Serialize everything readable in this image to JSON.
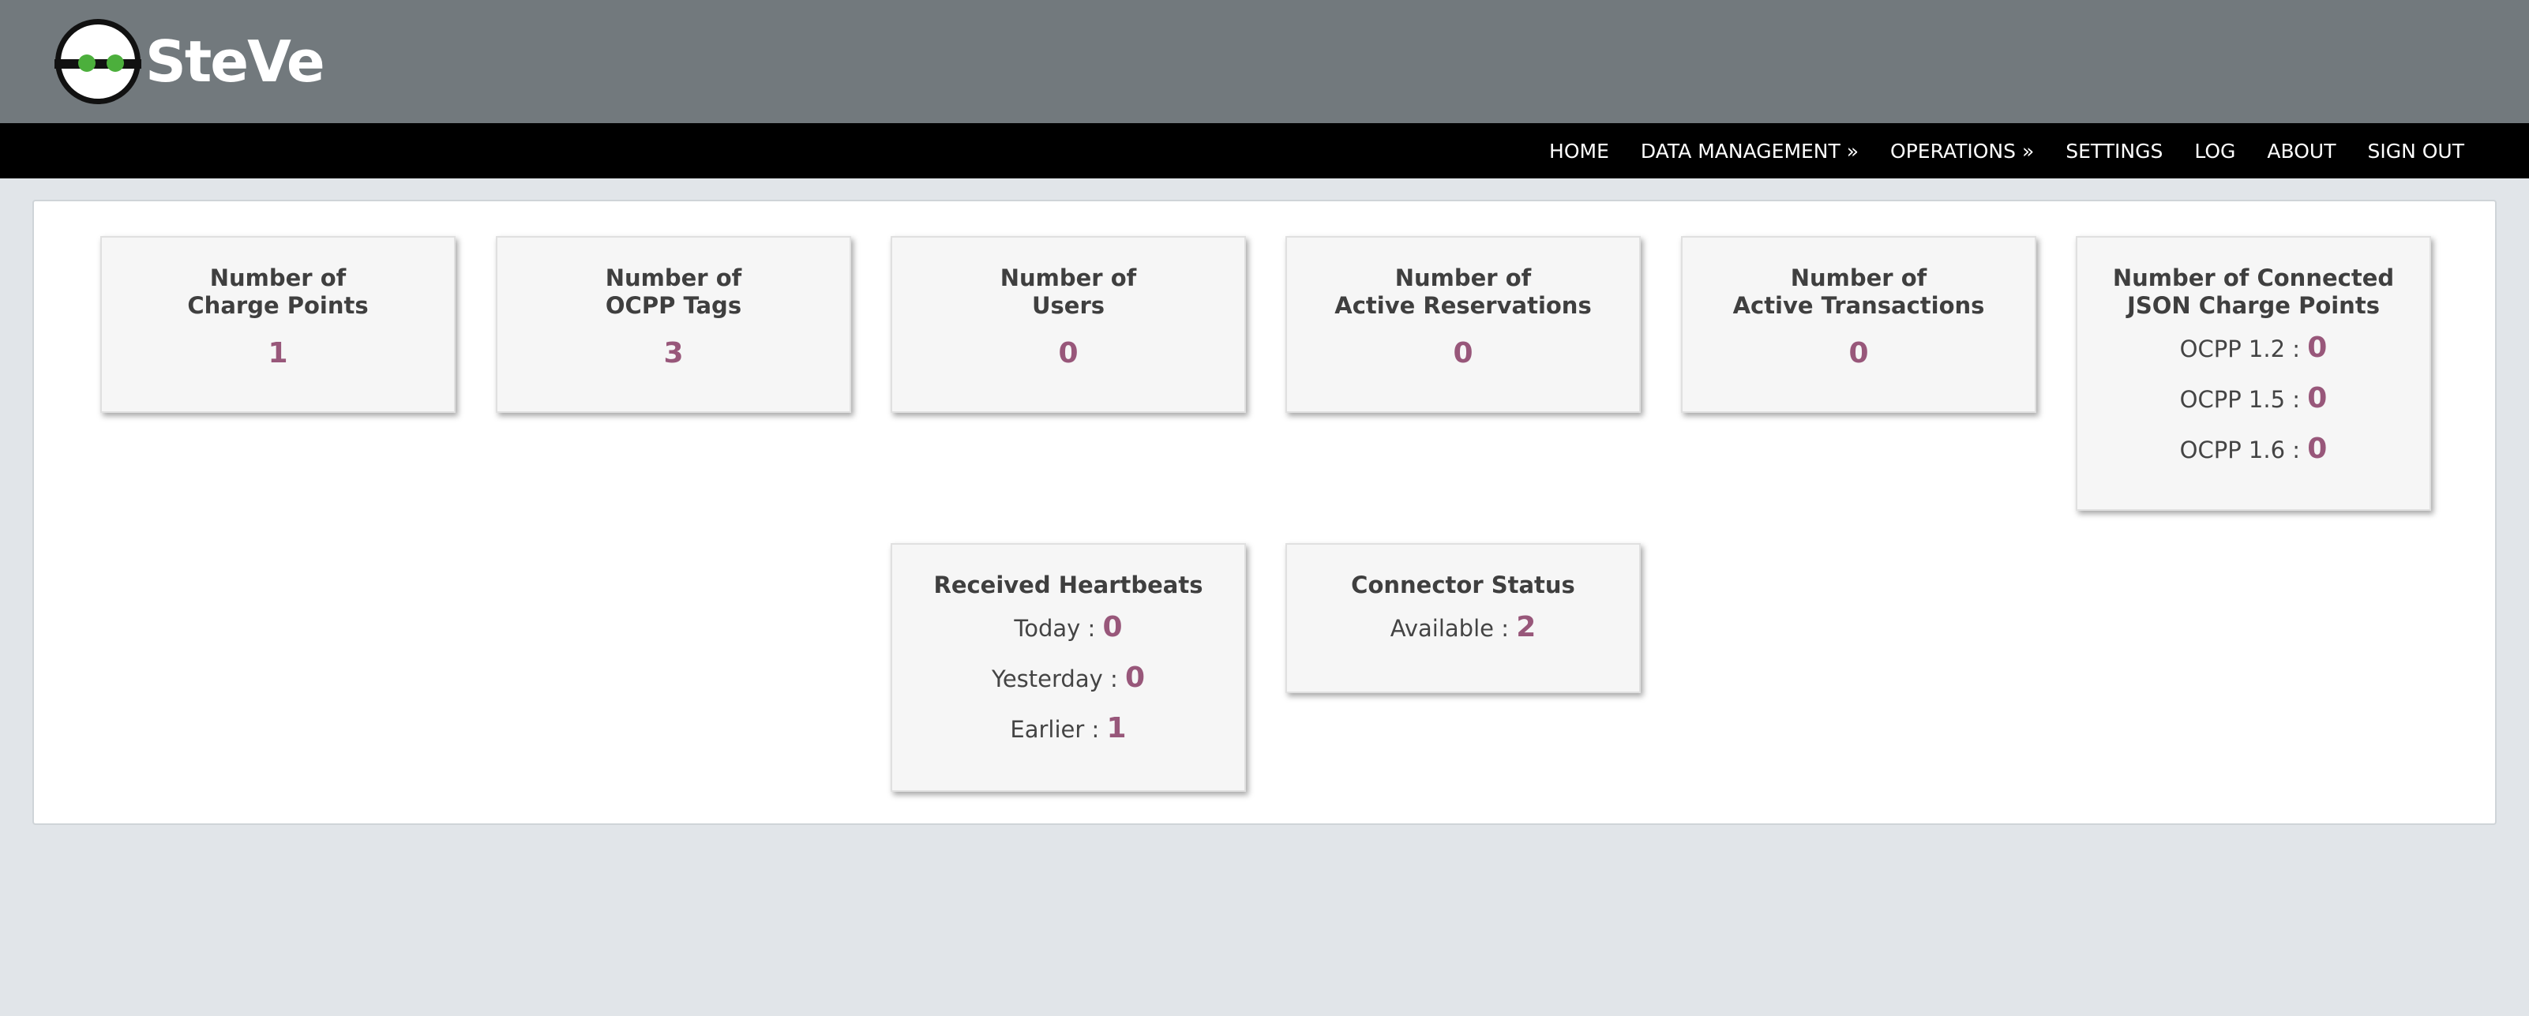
{
  "header": {
    "logo_text": "SteVe"
  },
  "nav": {
    "items": [
      "HOME",
      "DATA MANAGEMENT »",
      "OPERATIONS »",
      "SETTINGS",
      "LOG",
      "ABOUT",
      "SIGN OUT"
    ]
  },
  "stats": {
    "charge_points": {
      "line1": "Number of",
      "line2": "Charge Points",
      "value": "1"
    },
    "ocpp_tags": {
      "line1": "Number of",
      "line2": "OCPP Tags",
      "value": "3"
    },
    "users": {
      "line1": "Number of",
      "line2": "Users",
      "value": "0"
    },
    "reservations": {
      "line1": "Number of",
      "line2": "Active Reservations",
      "value": "0"
    },
    "transactions": {
      "line1": "Number of",
      "line2": "Active Transactions",
      "value": "0"
    },
    "json_cp": {
      "line1": "Number of Connected",
      "line2": "JSON Charge Points",
      "rows": [
        {
          "label": "OCPP 1.2",
          "value": "0"
        },
        {
          "label": "OCPP 1.5",
          "value": "0"
        },
        {
          "label": "OCPP 1.6",
          "value": "0"
        }
      ]
    },
    "heartbeats": {
      "title": "Received Heartbeats",
      "rows": [
        {
          "label": "Today",
          "value": "0"
        },
        {
          "label": "Yesterday",
          "value": "0"
        },
        {
          "label": "Earlier",
          "value": "1"
        }
      ]
    },
    "connector_status": {
      "title": "Connector Status",
      "rows": [
        {
          "label": "Available",
          "value": "2"
        }
      ]
    }
  },
  "colors": {
    "header_bg": "#72797d",
    "navbar_bg": "#000000",
    "value_color": "#98577a",
    "logo_eye": "#4caf3c"
  },
  "icons": {
    "logo": "steve-robot-head-icon"
  }
}
